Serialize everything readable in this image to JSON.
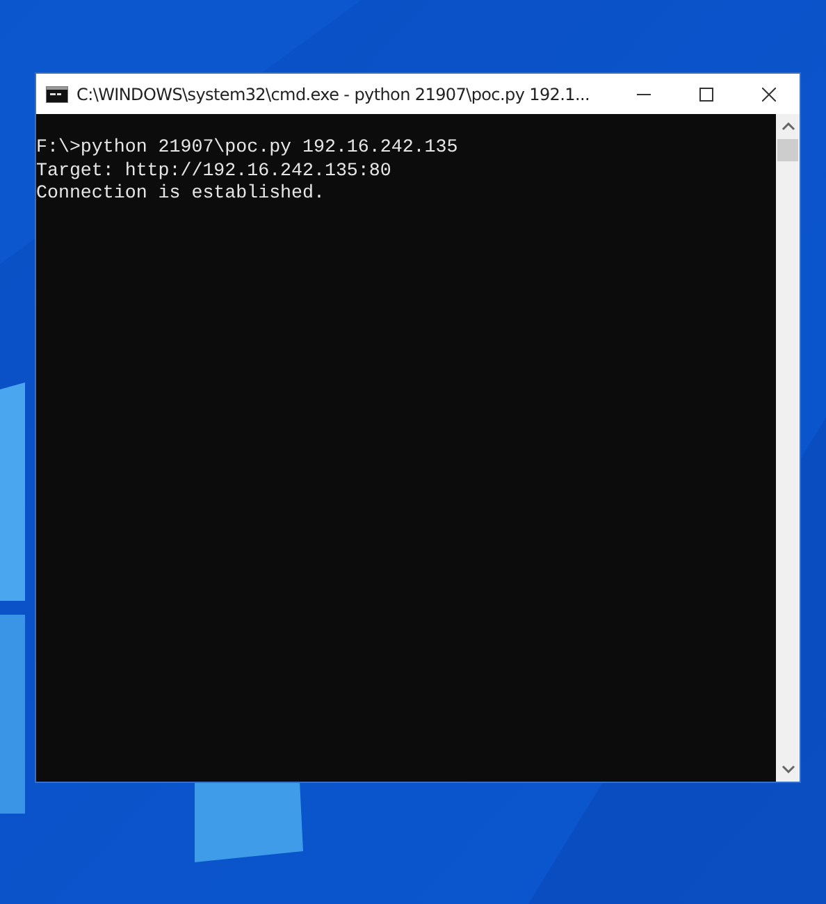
{
  "window": {
    "title": "C:\\WINDOWS\\system32\\cmd.exe - python  21907\\poc.py 192.1..."
  },
  "console": {
    "lines": [
      "F:\\>python 21907\\poc.py 192.16.242.135",
      "Target: http://192.16.242.135:80",
      "Connection is established."
    ]
  }
}
